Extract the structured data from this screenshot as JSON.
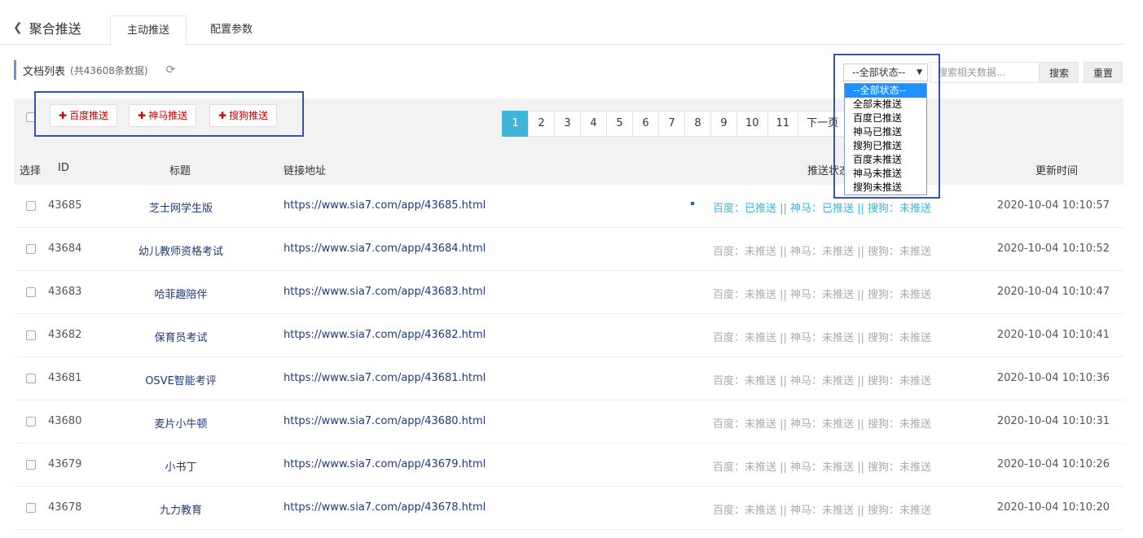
{
  "header": {
    "back_label": "聚合推送",
    "tabs": [
      {
        "label": "主动推送"
      },
      {
        "label": "配置参数"
      }
    ]
  },
  "list": {
    "title": "文档列表",
    "count_text": "(共43608条数据)"
  },
  "filter": {
    "selected": "--全部状态--",
    "options": [
      "--全部状态--",
      "全部未推送",
      "百度已推送",
      "神马已推送",
      "搜狗已推送",
      "百度未推送",
      "神马未推送",
      "搜狗未推送"
    ],
    "search_placeholder": "搜索相关数据...",
    "search_label": "搜索",
    "reset_label": "重置"
  },
  "actions": {
    "baidu_label": "百度推送",
    "shenma_label": "神马推送",
    "sogou_label": "搜狗推送"
  },
  "pagination": {
    "pages": [
      "1",
      "2",
      "3",
      "4",
      "5",
      "6",
      "7",
      "8",
      "9",
      "10",
      "11"
    ],
    "next_label": "下一页",
    "current": "1"
  },
  "table": {
    "headers": {
      "select": "选择",
      "id": "ID",
      "title": "标题",
      "link": "链接地址",
      "status": "推送状态",
      "time": "更新时间"
    },
    "rows": [
      {
        "id": "43685",
        "title": "芝士网学生版",
        "link": "https://www.sia7.com/app/43685.html",
        "status": "百度：已推送 || 神马：已推送 || 搜狗：未推送",
        "time": "2020-10-04 10:10:57"
      },
      {
        "id": "43684",
        "title": "幼儿教师资格考试",
        "link": "https://www.sia7.com/app/43684.html",
        "status": "百度：未推送 || 神马：未推送 || 搜狗：未推送",
        "time": "2020-10-04 10:10:52"
      },
      {
        "id": "43683",
        "title": "哈菲趣陪伴",
        "link": "https://www.sia7.com/app/43683.html",
        "status": "百度：未推送 || 神马：未推送 || 搜狗：未推送",
        "time": "2020-10-04 10:10:47"
      },
      {
        "id": "43682",
        "title": "保育员考试",
        "link": "https://www.sia7.com/app/43682.html",
        "status": "百度：未推送 || 神马：未推送 || 搜狗：未推送",
        "time": "2020-10-04 10:10:41"
      },
      {
        "id": "43681",
        "title": "OSVE智能考评",
        "link": "https://www.sia7.com/app/43681.html",
        "status": "百度：未推送 || 神马：未推送 || 搜狗：未推送",
        "time": "2020-10-04 10:10:36"
      },
      {
        "id": "43680",
        "title": "麦片小牛顿",
        "link": "https://www.sia7.com/app/43680.html",
        "status": "百度：未推送 || 神马：未推送 || 搜狗：未推送",
        "time": "2020-10-04 10:10:31"
      },
      {
        "id": "43679",
        "title": "小书丁",
        "link": "https://www.sia7.com/app/43679.html",
        "status": "百度：未推送 || 神马：未推送 || 搜狗：未推送",
        "time": "2020-10-04 10:10:26"
      },
      {
        "id": "43678",
        "title": "九力教育",
        "link": "https://www.sia7.com/app/43678.html",
        "status": "百度：未推送 || 神马：未推送 || 搜狗：未推送",
        "time": "2020-10-04 10:10:20"
      }
    ]
  },
  "colors": {
    "accent": "#3fb6d8",
    "highlight_border": "#3552b8",
    "push_red": "#cc0000",
    "link": "#1f3a7a"
  }
}
